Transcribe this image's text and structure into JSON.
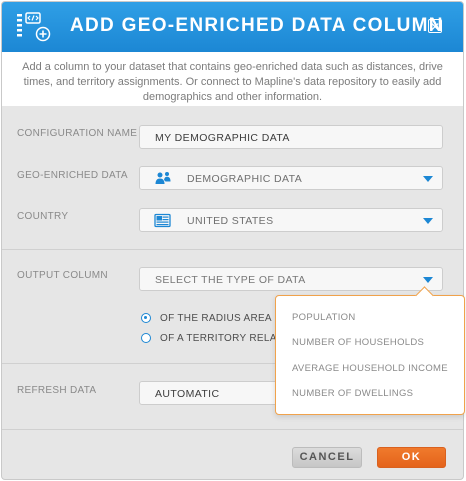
{
  "dialog": {
    "title": "ADD GEO-ENRICHED DATA COLUMN",
    "intro": "Add a column to your dataset that contains geo-enriched data such as distances, drive times, and territory assignments. Or connect to Mapline's data repository to easily add demographics and other information."
  },
  "form": {
    "config_name_label": "CONFIGURATION NAME",
    "config_name_value": "MY DEMOGRAPHIC DATA",
    "geo_label": "GEO-ENRICHED DATA",
    "geo_value": "DEMOGRAPHIC DATA",
    "country_label": "COUNTRY",
    "country_value": "UNITED STATES",
    "output_label": "OUTPUT COLUMN",
    "output_placeholder": "SELECT THE TYPE OF DATA",
    "radio_radius": "OF THE RADIUS AREA",
    "radio_territory": "OF A TERRITORY RELA",
    "refresh_label": "REFRESH DATA",
    "refresh_value": "AUTOMATIC"
  },
  "dropdown": {
    "items": [
      "POPULATION",
      "NUMBER OF HOUSEHOLDS",
      "AVERAGE HOUSEHOLD INCOME",
      "NUMBER OF DWELLINGS"
    ]
  },
  "buttons": {
    "cancel": "CANCEL",
    "ok": "OK"
  },
  "icons": {
    "header": "add-data-column-icon",
    "close": "close-icon",
    "demographic": "people-icon",
    "country": "flag-icon",
    "caret": "chevron-down-icon"
  },
  "colors": {
    "header": "#1c87d4",
    "accent": "#1c87d4",
    "ok_button": "#e96d24",
    "dropdown_border": "#f0a24b"
  }
}
